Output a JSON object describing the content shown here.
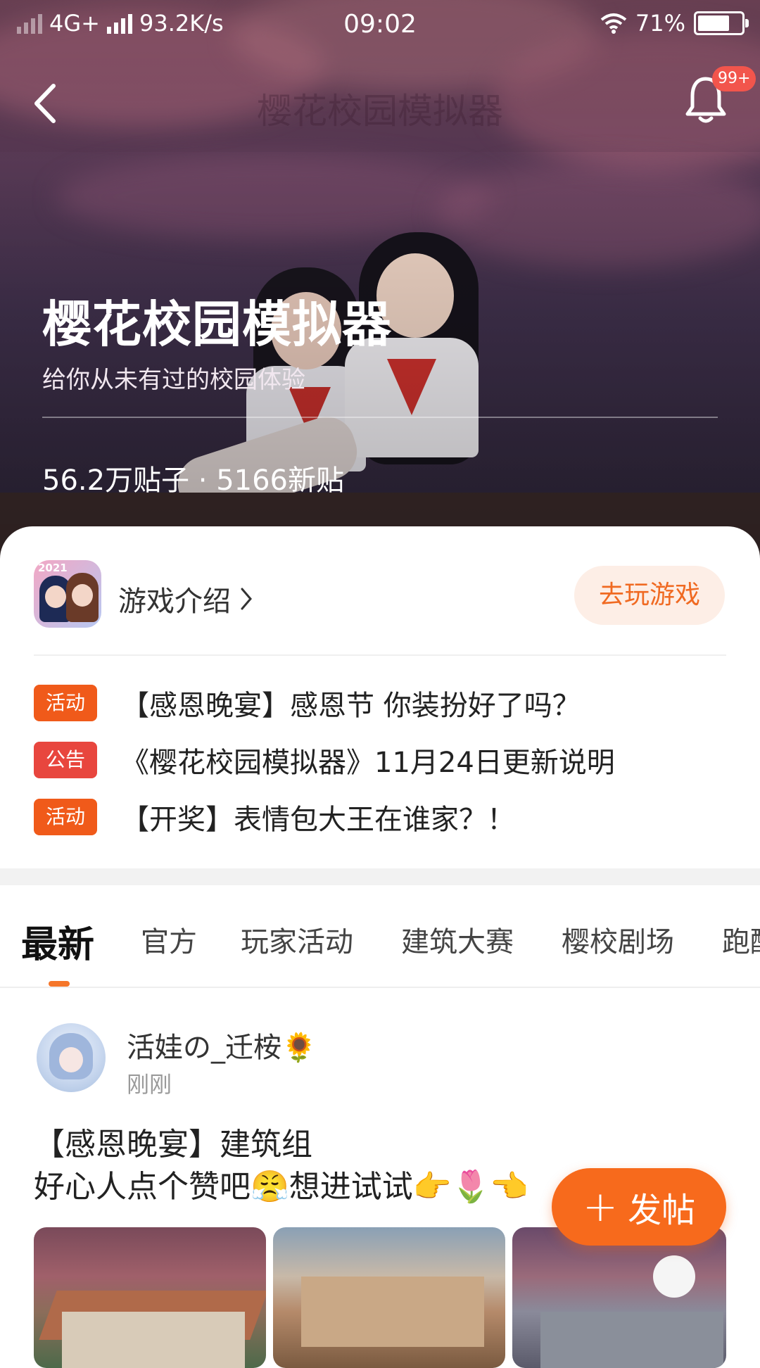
{
  "status_bar": {
    "network": "4G+",
    "speed": "93.2K/s",
    "time": "09:02",
    "battery": "71%"
  },
  "header": {
    "ghost_title": "樱花校园模拟器",
    "notification_badge": "99+",
    "icons": [
      "back-icon",
      "bell-icon"
    ]
  },
  "hero": {
    "title": "樱花校园模拟器",
    "subtitle": "给你从未有过的校园体验",
    "stats": "56.2万贴子 · 5166新贴"
  },
  "game_card": {
    "icon_year": "2021",
    "intro_label": "游戏介绍",
    "play_button": "去玩游戏",
    "play_button_color": "#f06a22",
    "notices": [
      {
        "tag": "活动",
        "text": "【感恩晚宴】感恩节 你装扮好了吗？"
      },
      {
        "tag": "公告",
        "text": "《樱花校园模拟器》11月24日更新说明"
      },
      {
        "tag": "活动",
        "text": "【开奖】表情包大王在谁家？！"
      }
    ]
  },
  "tabs": {
    "items": [
      "最新",
      "官方",
      "玩家活动",
      "建筑大赛",
      "樱校剧场",
      "跑酷"
    ],
    "active": "最新",
    "accent": "#f5762a"
  },
  "post": {
    "username": "活娃の_迁桉🌻",
    "time": "刚刚",
    "title": "【感恩晚宴】建筑组",
    "body": "好心人点个赞吧😤想进试试👉🌷👈"
  },
  "fab": {
    "label": "发帖",
    "color": "#f76a1c"
  }
}
